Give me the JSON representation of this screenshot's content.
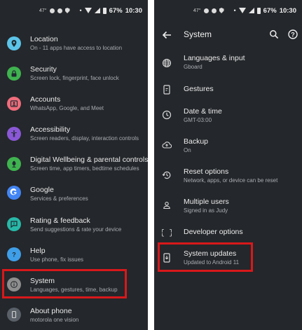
{
  "status_left": {
    "temp": "47°",
    "battery": "67%",
    "time": "10:30"
  },
  "status_right": {
    "temp": "47°",
    "battery": "67%",
    "time": "10:30"
  },
  "settings_list": [
    {
      "title": "Location",
      "subtitle": "On - 11 apps have access to location",
      "color": "#5cc4e8",
      "icon": "location-pin-icon"
    },
    {
      "title": "Security",
      "subtitle": "Screen lock, fingerprint, face unlock",
      "color": "#3fb34f",
      "icon": "lock-icon"
    },
    {
      "title": "Accounts",
      "subtitle": "WhatsApp, Google, and Meet",
      "color": "#f06d7c",
      "icon": "account-icon"
    },
    {
      "title": "Accessibility",
      "subtitle": "Screen readers, display, interaction controls",
      "color": "#8a58d6",
      "icon": "accessibility-icon"
    },
    {
      "title": "Digital Wellbeing & parental controls",
      "subtitle": "Screen time, app timers, bedtime schedules",
      "color": "#3fb34f",
      "icon": "wellbeing-icon"
    },
    {
      "title": "Google",
      "subtitle": "Services & preferences",
      "color": "#4285f4",
      "icon": "google-icon"
    },
    {
      "title": "Rating & feedback",
      "subtitle": "Send suggestions & rate your device",
      "color": "#28b8a8",
      "icon": "feedback-icon"
    },
    {
      "title": "Help",
      "subtitle": "Use phone, fix issues",
      "color": "#3f9ee8",
      "icon": "help-icon"
    },
    {
      "title": "System",
      "subtitle": "Languages, gestures, time, backup",
      "color": "#8e8e8e",
      "icon": "info-icon"
    },
    {
      "title": "About phone",
      "subtitle": "motorola one vision",
      "color": "#5a6068",
      "icon": "phone-icon"
    }
  ],
  "system_page": {
    "title": "System",
    "items": [
      {
        "title": "Languages & input",
        "subtitle": "Gboard",
        "icon": "globe-icon"
      },
      {
        "title": "Gestures",
        "subtitle": "",
        "icon": "gesture-phone-icon"
      },
      {
        "title": "Date & time",
        "subtitle": "GMT-03:00",
        "icon": "clock-icon"
      },
      {
        "title": "Backup",
        "subtitle": "On",
        "icon": "cloud-upload-icon"
      },
      {
        "title": "Reset options",
        "subtitle": "Network, apps, or device can be reset",
        "icon": "history-icon"
      },
      {
        "title": "Multiple users",
        "subtitle": "Signed in as Judy",
        "icon": "person-icon"
      },
      {
        "title": "Developer options",
        "subtitle": "",
        "icon": "code-braces-icon"
      },
      {
        "title": "System updates",
        "subtitle": "Updated to Android 11",
        "icon": "system-update-icon"
      }
    ]
  }
}
